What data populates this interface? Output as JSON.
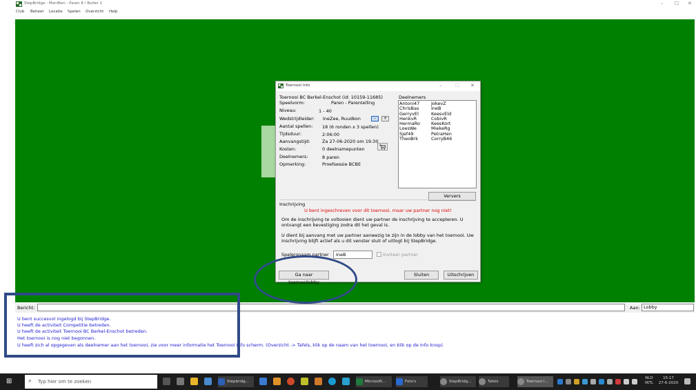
{
  "window": {
    "title": "StepBridge - MoniBen - Paren 8 / Butler 1",
    "controls": [
      "–",
      "☐",
      "✕"
    ]
  },
  "menu": [
    "Club",
    "Beheer",
    "Locatie",
    "Spelen",
    "Overzicht",
    "Help"
  ],
  "dialog": {
    "title": "Toernooi Info",
    "controls": [
      "–",
      "☐",
      "✕"
    ],
    "heading": "Toernooi BC Berkel-Enschot (id: 10159-11685)",
    "fields": [
      {
        "label": "Speelvorm:",
        "value": "Paren - Parentelling"
      },
      {
        "label": "Niveau:",
        "value": "1 - 40"
      },
      {
        "label": "Wedstrijdleider:",
        "value": "IneZee, Ruudkon"
      },
      {
        "label": "Aantal spellen:",
        "value": "18 (6 ronden x 3 spellen)"
      },
      {
        "label": "Tijdsduur:",
        "value": "2:06:00"
      },
      {
        "label": "Aanvangstijd:",
        "value": "Za 27-06-2020 om 19:30"
      },
      {
        "label": "Kosten:",
        "value": "0 deelnamepunten"
      },
      {
        "label": "Deelnemers:",
        "value": "8 paren"
      },
      {
        "label": "Opmerking:",
        "value": "Proefsessie BCBE"
      }
    ],
    "minus_label": "-",
    "plus_label": "+",
    "cart_icon": "cart-icon",
    "players_label": "Deelnemers",
    "players_col1": [
      "Antoni47",
      "ChrisBas",
      "GerryvEl",
      "HenkvR",
      "HermaRo",
      "LoesWe",
      "Sjef49",
      "TheoBrk"
    ],
    "players_col2": [
      "JokevZ",
      "IneB",
      "KeesvEld",
      "CobivR",
      "KeesKort",
      "MiekeRg",
      "PetraHen",
      "CorryB46"
    ],
    "refresh_label": "Ververs",
    "section_label": "Inschrijving",
    "status_msg": "U bent ingeschreven voor dit toernooi, maar uw partner nog niet!",
    "para1": "Om de inschrijving te voltooien dient uw partner de inschrijving te accepteren. U ontvangt een bevestiging zodra dit het geval is.",
    "para2": "U dient bij aanvang met uw partner aanwezig te zijn in de lobby van het toernooi. Uw inschrijving blijft actief als u dit venster sluit of uitlogt bij StepBridge.",
    "partner_label": "Spelersnaam partner",
    "partner_value": "IneB",
    "invite_label": "Inviteer partner",
    "lobby_button": "Ga naar toernooilobby",
    "close_button": "Sluiten",
    "unsubscribe_button": "Uitschrijven"
  },
  "message_bar": {
    "label": "Bericht:",
    "to_label": "Aan:",
    "to_value": "Lobby"
  },
  "log": [
    "U bent succesvol ingelogd bij StepBridge.",
    "U heeft de activiteit Competitie betreden.",
    "U heeft de activiteit Toernooi BC Berkel-Enschot betreden.",
    "Het toernooi is nog niet begonnen.",
    "U heeft zich al opgegeven als deelnemer aan het toernooi, zie voor meer informatie het Toernooi Info scherm. (Overzicht -> Tafels, klik op de naam van het toernooi, en klik op de Info knop)."
  ],
  "taskbar": {
    "search_placeholder": "Typ hier om te zoeken",
    "apps": [
      "Stepbridg...",
      "Microsoft...",
      "Foto's",
      "StepBridg...",
      "Tafels",
      "Toernooi I..."
    ],
    "lang": "NLD",
    "lang_sub": "INTL",
    "time": "15:17",
    "date": "27-6-2020"
  },
  "colors": {
    "table_green": "#008000",
    "log_blue": "#1a1ad0",
    "annotation": "#2f4a87",
    "warning_red": "#e00000"
  }
}
